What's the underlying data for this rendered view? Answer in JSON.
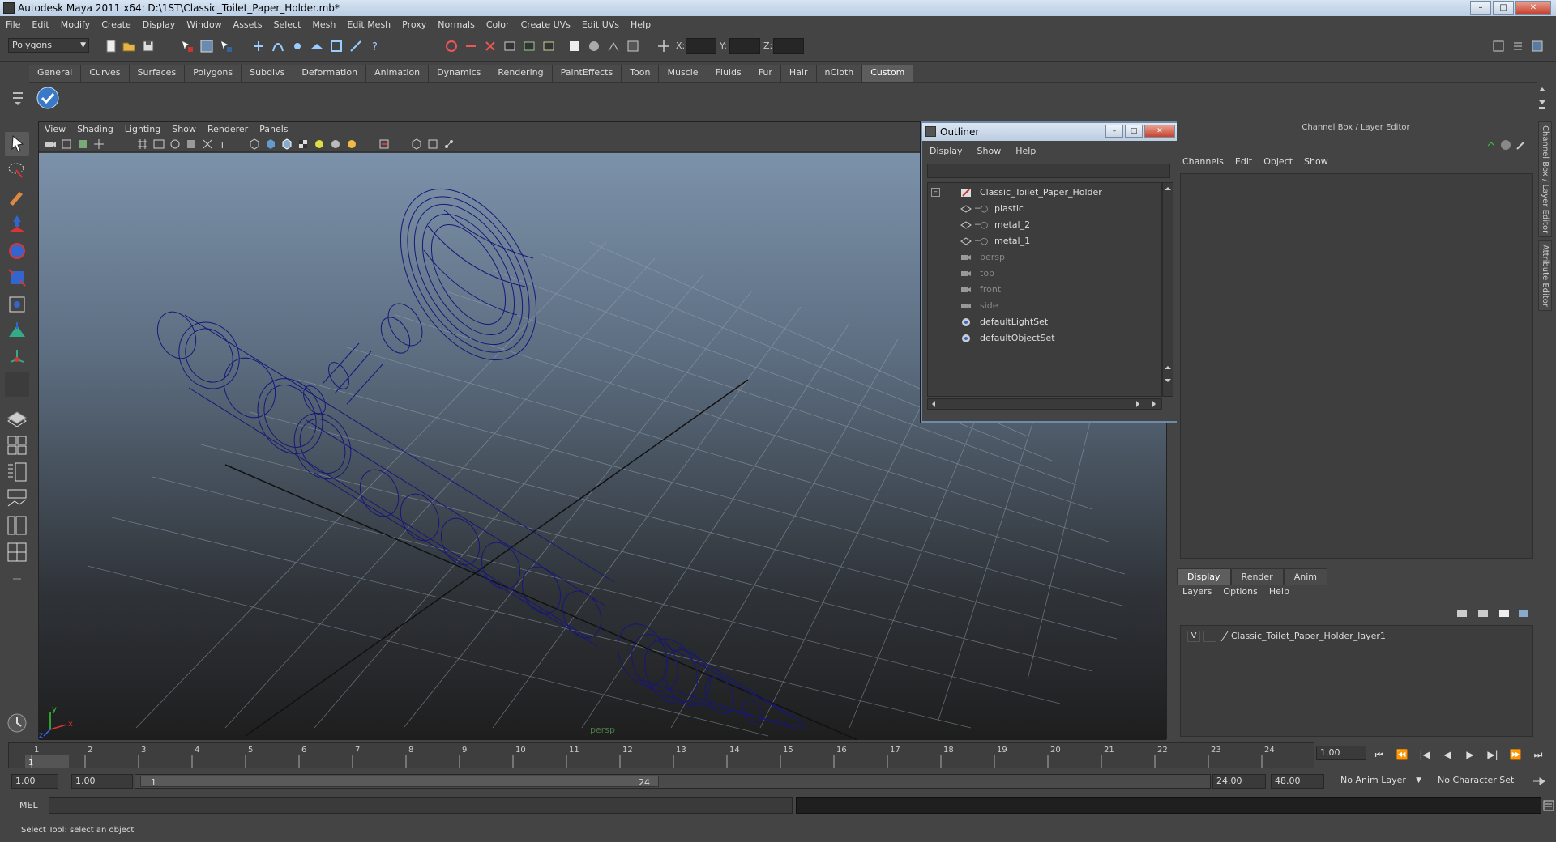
{
  "window": {
    "title": "Autodesk Maya 2011 x64: D:\\1ST\\Classic_Toilet_Paper_Holder.mb*",
    "minimize": "–",
    "maximize": "□",
    "close": "✕"
  },
  "menubar": [
    "File",
    "Edit",
    "Modify",
    "Create",
    "Display",
    "Window",
    "Assets",
    "Select",
    "Mesh",
    "Edit Mesh",
    "Proxy",
    "Normals",
    "Color",
    "Create UVs",
    "Edit UVs",
    "Help"
  ],
  "statusline": {
    "mode": "Polygons",
    "coord_labels": {
      "x": "X:",
      "y": "Y:",
      "z": "Z:"
    }
  },
  "shelf": {
    "tabs": [
      "General",
      "Curves",
      "Surfaces",
      "Polygons",
      "Subdivs",
      "Deformation",
      "Animation",
      "Dynamics",
      "Rendering",
      "PaintEffects",
      "Toon",
      "Muscle",
      "Fluids",
      "Fur",
      "Hair",
      "nCloth",
      "Custom"
    ],
    "active_tab": "Custom"
  },
  "viewport": {
    "menu": [
      "View",
      "Shading",
      "Lighting",
      "Show",
      "Renderer",
      "Panels"
    ],
    "camera_label": "persp"
  },
  "outliner": {
    "title": "Outliner",
    "menu": [
      "Display",
      "Show",
      "Help"
    ],
    "items": [
      {
        "label": "Classic_Toilet_Paper_Holder",
        "dim": false,
        "indent": 0,
        "expander": "–",
        "type": "transform"
      },
      {
        "label": "plastic",
        "dim": false,
        "indent": 1,
        "type": "mesh"
      },
      {
        "label": "metal_2",
        "dim": false,
        "indent": 1,
        "type": "mesh"
      },
      {
        "label": "metal_1",
        "dim": false,
        "indent": 1,
        "type": "mesh"
      },
      {
        "label": "persp",
        "dim": true,
        "indent": 0,
        "type": "camera"
      },
      {
        "label": "top",
        "dim": true,
        "indent": 0,
        "type": "camera"
      },
      {
        "label": "front",
        "dim": true,
        "indent": 0,
        "type": "camera"
      },
      {
        "label": "side",
        "dim": true,
        "indent": 0,
        "type": "camera"
      },
      {
        "label": "defaultLightSet",
        "dim": false,
        "indent": 0,
        "type": "set"
      },
      {
        "label": "defaultObjectSet",
        "dim": false,
        "indent": 0,
        "type": "set"
      }
    ]
  },
  "channelbox": {
    "header": "Channel Box / Layer Editor",
    "menu": [
      "Channels",
      "Edit",
      "Object",
      "Show"
    ],
    "side_tabs": [
      "Channel Box / Layer Editor",
      "Attribute Editor"
    ]
  },
  "layer_editor": {
    "tabs": [
      "Display",
      "Render",
      "Anim"
    ],
    "active_tab": "Display",
    "menu": [
      "Layers",
      "Options",
      "Help"
    ],
    "layers": [
      {
        "visible": "V",
        "name": "Classic_Toilet_Paper_Holder_layer1"
      }
    ]
  },
  "timeline": {
    "ticks": [
      "1",
      "2",
      "3",
      "4",
      "5",
      "6",
      "7",
      "8",
      "9",
      "10",
      "11",
      "12",
      "13",
      "14",
      "15",
      "16",
      "17",
      "18",
      "19",
      "20",
      "21",
      "22",
      "23",
      "24"
    ],
    "current_frame": "1",
    "current_time_field": "1.00"
  },
  "range": {
    "start_field": "1.00",
    "playback_start": "1.00",
    "slider_start": "1",
    "slider_end": "24",
    "playback_end": "24.00",
    "end_field": "48.00",
    "anim_layer": "No Anim Layer",
    "character_set": "No Character Set"
  },
  "playback": [
    "⏮",
    "⏪",
    "|◀",
    "◀",
    "▶",
    "▶|",
    "⏩",
    "⏭"
  ],
  "mel": {
    "label": "MEL"
  },
  "helpline": {
    "text": "Select Tool: select an object"
  },
  "colors": {
    "wireframe": "#17177a",
    "ui_bg": "#444444"
  }
}
